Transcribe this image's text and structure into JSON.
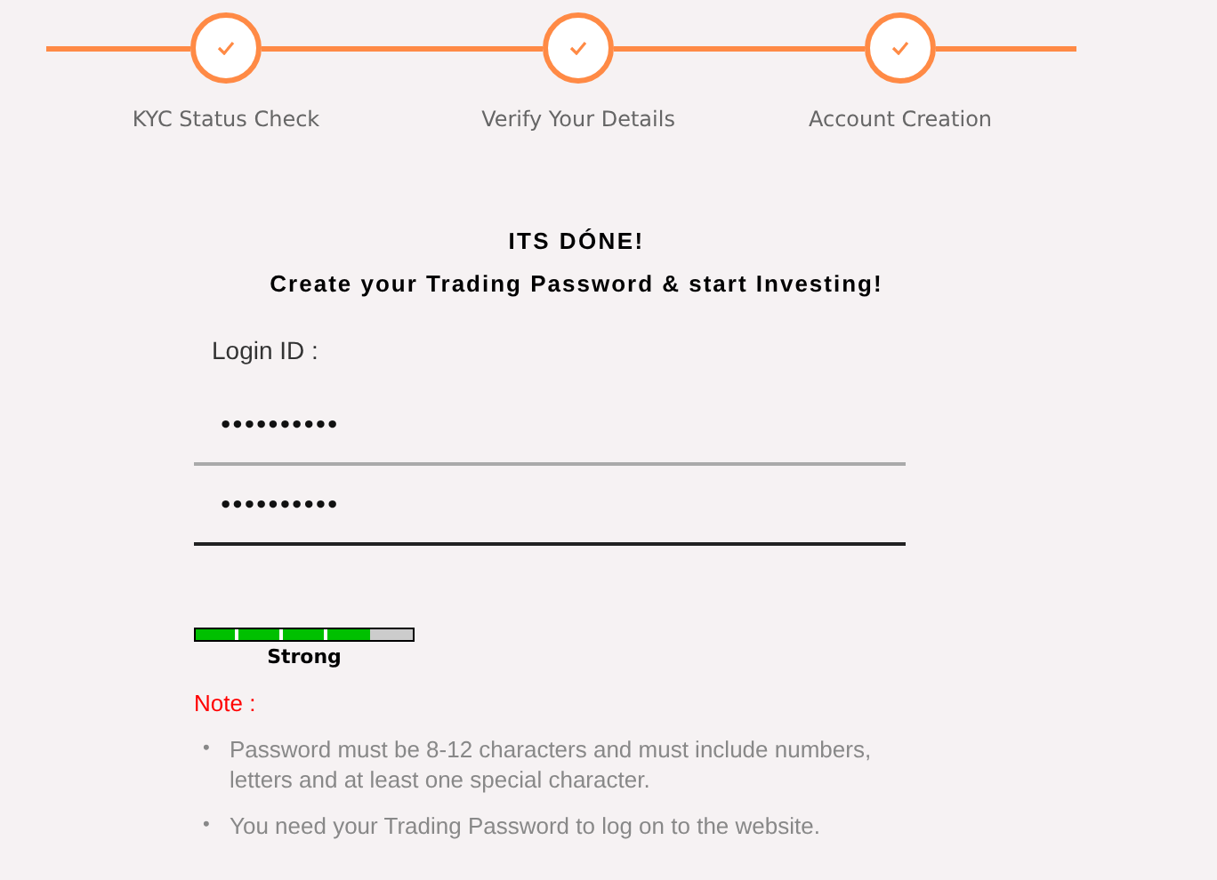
{
  "steps": [
    {
      "label": "KYC Status Check",
      "completed": true
    },
    {
      "label": "Verify Your Details",
      "completed": true
    },
    {
      "label": "Account Creation",
      "completed": true
    }
  ],
  "heading": "ITS DÓNE!",
  "subheading": "Create your Trading Password & start Investing!",
  "login_label": "Login ID :",
  "fields": [
    {
      "value": "••••••••••",
      "focused": false
    },
    {
      "value": "••••••••••",
      "focused": true
    }
  ],
  "strength": {
    "level": 0.8,
    "label": "Strong"
  },
  "note": {
    "title": "Note :",
    "items": [
      {
        "bullet": "•",
        "text": "Password must be 8-12 characters and must include numbers, letters and at least one special character."
      },
      {
        "bullet": "•",
        "text": "You need your Trading Password to log on to the website."
      }
    ]
  }
}
